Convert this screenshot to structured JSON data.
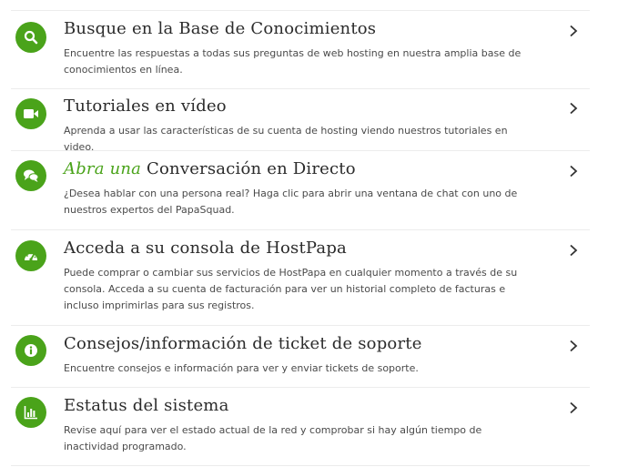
{
  "items": [
    {
      "title": "Busque en la Base de Conocimientos",
      "description": "Encuentre las respuestas a todas sus preguntas de web hosting en nuestra amplia base de conocimientos en línea."
    },
    {
      "title": "Tutoriales en vídeo",
      "description": "Aprenda a usar las características de su cuenta de hosting viendo nuestros tutoriales en video."
    },
    {
      "title_accent": "Abra una",
      "title": "Conversación en Directo",
      "description": "¿Desea hablar con una persona real? Haga clic para abrir una ventana de chat con uno de nuestros expertos del PapaSquad."
    },
    {
      "title": "Acceda a su consola de HostPapa",
      "description": "Puede comprar o cambiar sus servicios de HostPapa en cualquier momento a través de su consola. Acceda a su cuenta de facturación para ver un historial completo de facturas e incluso imprimirlas para sus registros."
    },
    {
      "title": "Consejos/información de ticket de soporte",
      "description": "Encuentre consejos e información para ver y enviar tickets de soporte."
    },
    {
      "title": "Estatus del sistema",
      "description": "Revise aquí para ver el estado actual de la red y comprobar si hay algún tiempo de inactividad programado."
    }
  ],
  "icons": [
    "search-icon",
    "video-camera-icon",
    "chat-bubbles-icon",
    "dashboard-gauge-icon",
    "info-icon",
    "bar-chart-icon"
  ],
  "colors": {
    "accent": "#4aa31a",
    "title_text": "#2b2b2b",
    "body_text": "#4a4a4a",
    "divider": "#ececec"
  }
}
